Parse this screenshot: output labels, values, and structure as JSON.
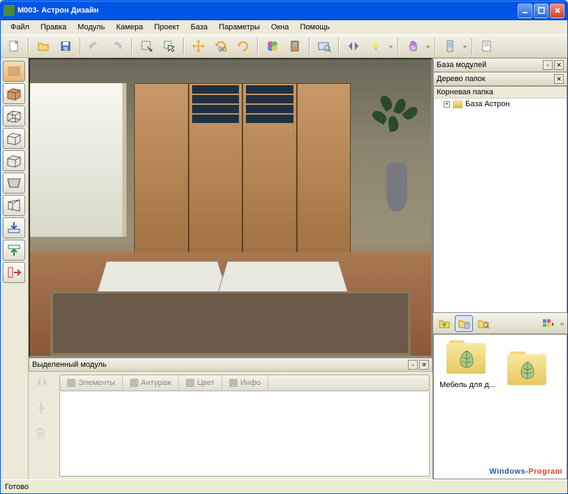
{
  "title": "М003- Астрон Дизайн",
  "menu": [
    "Файл",
    "Правка",
    "Модуль",
    "Камера",
    "Проект",
    "База",
    "Параметры",
    "Окна",
    "Помощь"
  ],
  "toolbar_icons": [
    "new",
    "open",
    "save",
    "undo",
    "redo",
    "select-rect",
    "select-arrow",
    "move",
    "rotate-90",
    "rotate",
    "colors",
    "door",
    "view",
    "mirror",
    "light",
    "hand",
    "phone",
    "doc"
  ],
  "right_panel": {
    "title": "База модулей",
    "subtitle": "Дерево папок",
    "root": "Корневая папка",
    "tree_item": "База Астрон"
  },
  "bottom_panel": {
    "title": "Выделенный модуль",
    "tabs": [
      "Элементы",
      "Антураж",
      "Цвет",
      "Инфо"
    ]
  },
  "catalog": {
    "item1": "Мебель для д..."
  },
  "status": "Готово",
  "watermark1": "Windows-",
  "watermark2": "Program"
}
